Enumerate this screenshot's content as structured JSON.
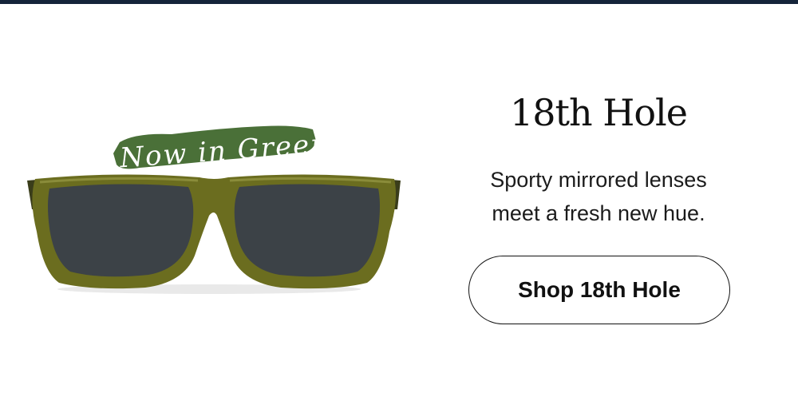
{
  "badge": {
    "text": "Now in Green"
  },
  "product": {
    "name": "18th Hole",
    "description_line1": "Sporty mirrored lenses",
    "description_line2": "meet a fresh new hue.",
    "frame_color": "#6b6d1f",
    "lens_color": "#3c4247"
  },
  "cta": {
    "label": "Shop 18th Hole"
  },
  "colors": {
    "top_bar": "#15243a",
    "badge_background": "#4a7038",
    "text": "#111111"
  }
}
